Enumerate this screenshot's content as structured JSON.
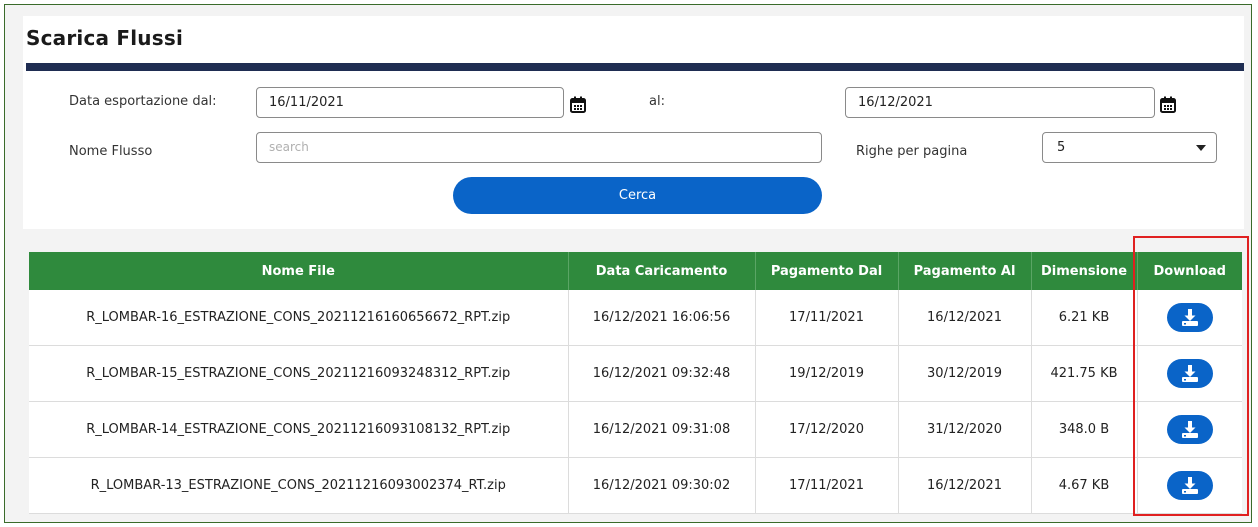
{
  "page": {
    "title": "Scarica Flussi"
  },
  "filters": {
    "date_from_label": "Data esportazione dal:",
    "date_from_value": "16/11/2021",
    "date_to_label": "al:",
    "date_to_value": "16/12/2021",
    "name_label": "Nome Flusso",
    "name_placeholder": "search",
    "rows_label": "Righe per pagina",
    "rows_value": "5",
    "search_button": "Cerca"
  },
  "table": {
    "headers": [
      "Nome File",
      "Data Caricamento",
      "Pagamento Dal",
      "Pagamento Al",
      "Dimensione",
      "Download"
    ],
    "rows": [
      {
        "file": "R_LOMBAR-16_ESTRAZIONE_CONS_20211216160656672_RPT.zip",
        "loaded": "16/12/2021 16:06:56",
        "from": "17/11/2021",
        "to": "16/12/2021",
        "size": "6.21 KB"
      },
      {
        "file": "R_LOMBAR-15_ESTRAZIONE_CONS_20211216093248312_RPT.zip",
        "loaded": "16/12/2021 09:32:48",
        "from": "19/12/2019",
        "to": "30/12/2019",
        "size": "421.75 KB"
      },
      {
        "file": "R_LOMBAR-14_ESTRAZIONE_CONS_20211216093108132_RPT.zip",
        "loaded": "16/12/2021 09:31:08",
        "from": "17/12/2020",
        "to": "31/12/2020",
        "size": "348.0 B"
      },
      {
        "file": "R_LOMBAR-13_ESTRAZIONE_CONS_20211216093002374_RT.zip",
        "loaded": "16/12/2021 09:30:02",
        "from": "17/11/2021",
        "to": "16/12/2021",
        "size": "4.67 KB"
      }
    ]
  },
  "icons": {
    "calendar": "calendar-icon",
    "download": "download-icon",
    "dropdown": "chevron-down-icon"
  },
  "colors": {
    "header_green": "#2f8a3d",
    "button_blue": "#0a64c8",
    "title_bar": "#1f2d52",
    "highlight_red": "#e02020"
  }
}
